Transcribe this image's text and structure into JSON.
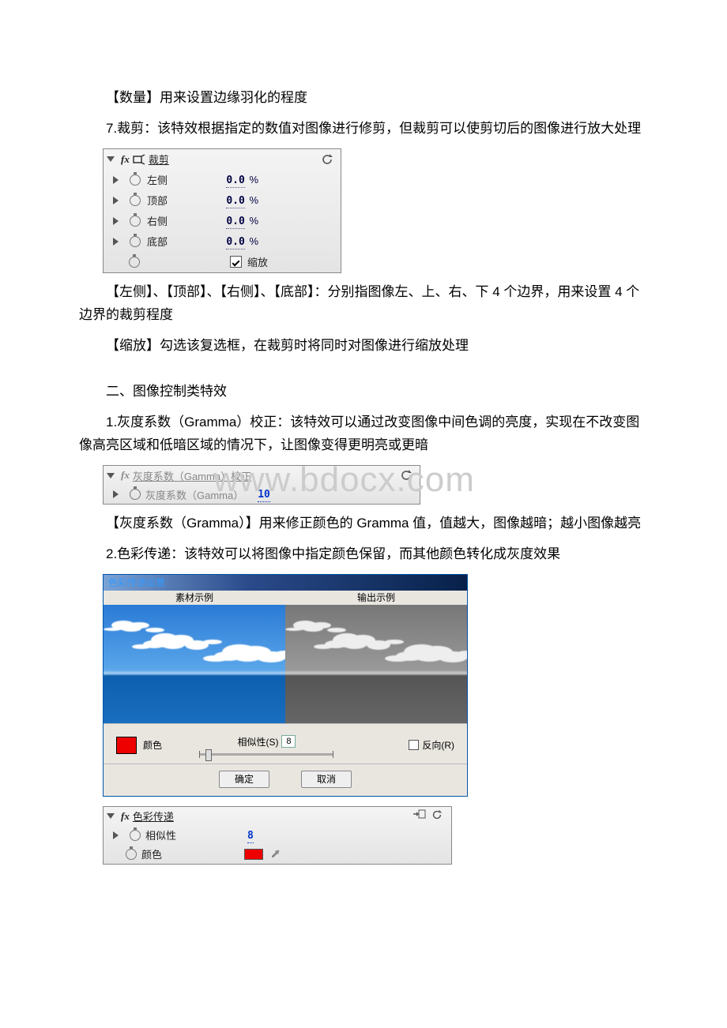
{
  "para1": "【数量】用来设置边缘羽化的程度",
  "para2": "7.裁剪：该特效根据指定的数值对图像进行修剪，但裁剪可以使剪切后的图像进行放大处理",
  "crop_panel": {
    "title": "裁剪",
    "rows": [
      {
        "label": "左侧",
        "val": "0.0",
        "pct": "%"
      },
      {
        "label": "顶部",
        "val": "0.0",
        "pct": "%"
      },
      {
        "label": "右侧",
        "val": "0.0",
        "pct": "%"
      },
      {
        "label": "底部",
        "val": "0.0",
        "pct": "%"
      }
    ],
    "scale": "缩放"
  },
  "para3": "【左侧】、【顶部】、【右侧】、【底部】：分别指图像左、上、右、下 4 个边界，用来设置 4 个边界的裁剪程度",
  "para4": "【缩放】勾选该复选框，在裁剪时将同时对图像进行缩放处理",
  "heading2": "二、图像控制类特效",
  "para5": "1.灰度系数（Gramma）校正：该特效可以通过改变图像中间色调的亮度，实现在不改变图像高亮区域和低暗区域的情况下，让图像变得更明亮或更暗",
  "gamma_panel": {
    "title": "灰度系数（Gamma）校正",
    "row_label": "灰度系数（Gamma）",
    "row_val": "10"
  },
  "watermark": "www.bdocx.com",
  "para6": "【灰度系数（Gramma）】用来修正颜色的 Gramma 值，值越大，图像越暗；越小图像越亮",
  "para7": "2.色彩传递：该特效可以将图像中指定颜色保留，而其他颜色转化成灰度效果",
  "dialog": {
    "title": "色彩传递设置",
    "src_label": "素材示例",
    "out_label": "输出示例",
    "color_label": "颜色",
    "sim_label": "相似性(S)",
    "sim_val": "8",
    "rev_label": "反向(R)",
    "ok": "确定",
    "cancel": "取消"
  },
  "pass_panel": {
    "title": "色彩传递",
    "row1_label": "相似性",
    "row1_val": "8",
    "row2_label": "颜色"
  }
}
